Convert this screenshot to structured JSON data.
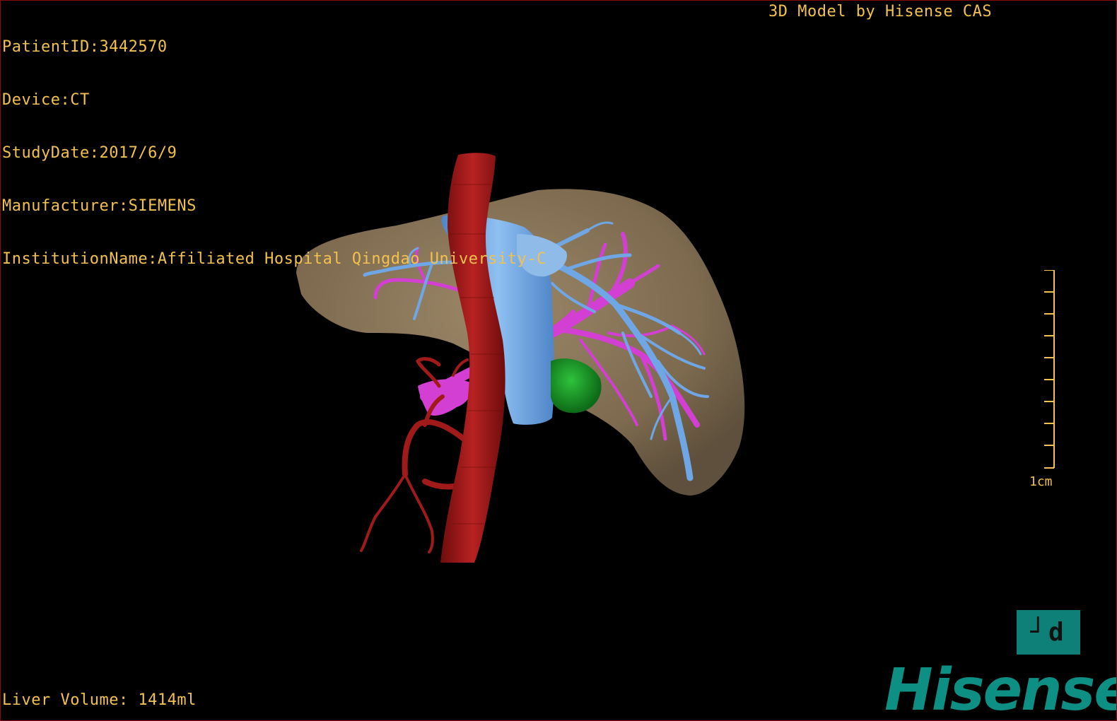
{
  "info": {
    "patient_id": "PatientID:3442570",
    "device": "Device:CT",
    "study_date": "StudyDate:2017/6/9",
    "manufacturer": "Manufacturer:SIEMENS",
    "institution": "InstitutionName:Affiliated Hospital Qingdao University-C"
  },
  "title": "3D Model by Hisense CAS",
  "liver_volume": "Liver Volume: 1414ml",
  "scale": {
    "label": "1cm"
  },
  "view_toggle": {
    "label": "┘d"
  },
  "logo": "Hisense",
  "colors": {
    "text": "#f2c14e",
    "liver": "#8a7658",
    "artery": "#a11a1a",
    "portal_vein": "#d23fd2",
    "hepatic_vein": "#6fa7e6",
    "gallbladder": "#1f9d2b",
    "logo": "#0d8f83"
  }
}
